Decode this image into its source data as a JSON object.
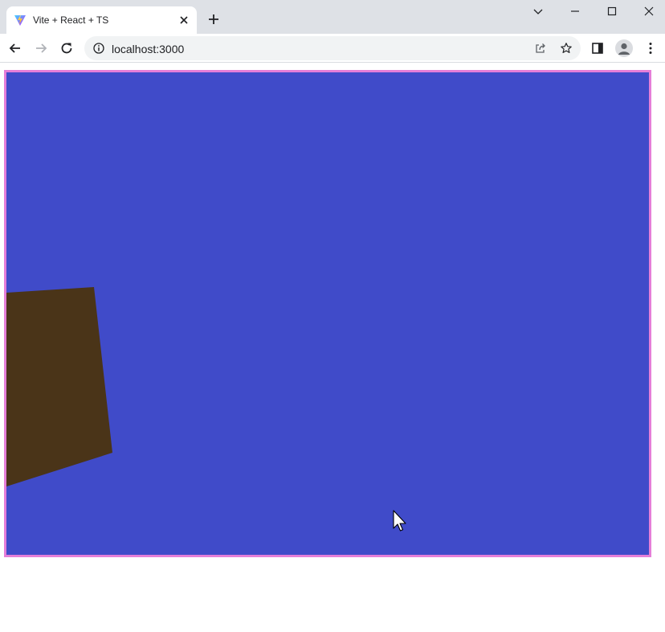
{
  "browser": {
    "tab": {
      "title": "Vite + React + TS",
      "favicon": "vite-logo",
      "close_icon": "close-icon"
    },
    "new_tab_icon": "plus-icon",
    "window_controls": [
      "chevron-down-icon",
      "minimize-icon",
      "maximize-icon",
      "close-icon"
    ],
    "toolbar": {
      "back_icon": "arrow-left-icon",
      "forward_icon": "arrow-right-icon",
      "reload_icon": "reload-icon",
      "side_panel_icon": "side-panel-icon",
      "profile_icon": "person-icon",
      "menu_icon": "kebab-menu-icon"
    },
    "omnibox": {
      "info_icon": "info-icon",
      "url": "localhost:3000",
      "share_icon": "share-icon",
      "bookmark_icon": "star-icon"
    }
  },
  "page": {
    "canvas": {
      "background_color": "#404bc9",
      "border_color": "#e57ed8",
      "shape_color": "#4a3418"
    }
  },
  "colors": {
    "tabstrip": "#dee1e6",
    "omnibox": "#f1f3f4",
    "text": "#202124",
    "icon": "#5f6368"
  }
}
